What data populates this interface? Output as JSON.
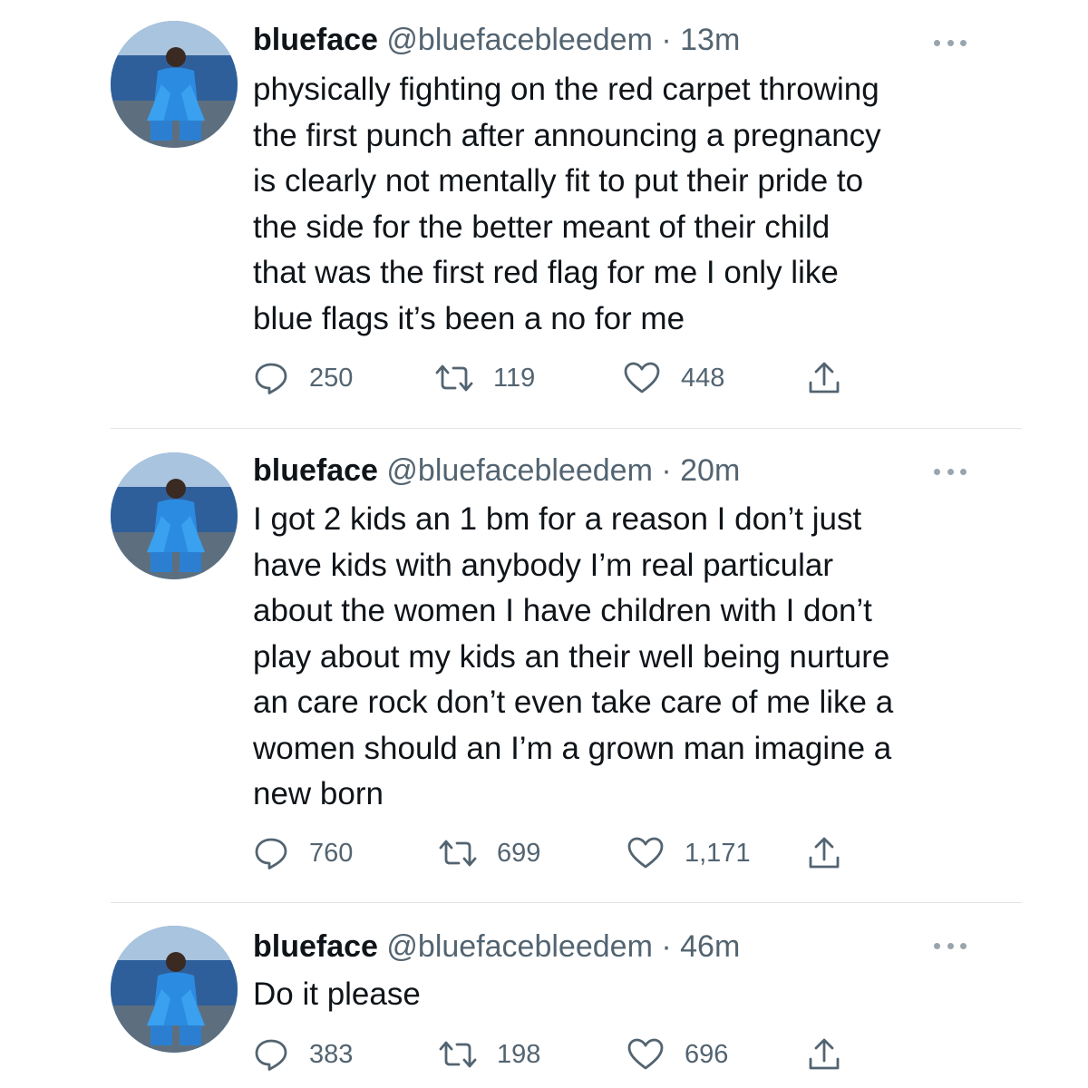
{
  "colors": {
    "text": "#0f1419",
    "secondary": "#536471",
    "divider": "#e2e5e8",
    "background": "#ffffff"
  },
  "icons": {
    "reply": "reply-icon",
    "retweet": "retweet-icon",
    "like": "heart-icon",
    "share": "share-icon",
    "more": "more-options-icon"
  },
  "tweets": [
    {
      "name": "blueface",
      "handle": "@bluefacebleedem",
      "separator": "·",
      "time": "13m",
      "lines": [
        "physically fighting on the red carpet throwing",
        "the first punch after announcing a pregnancy",
        "is clearly not mentally fit to put their pride to",
        "the side for the better meant of their child",
        "that was the first red flag for me I only like",
        "blue flags it’s been a no for me"
      ],
      "replies": "250",
      "retweets": "119",
      "likes": "448"
    },
    {
      "name": "blueface",
      "handle": "@bluefacebleedem",
      "separator": "·",
      "time": "20m",
      "lines": [
        "I got 2 kids an 1 bm for a reason I don’t just",
        "have kids with anybody I’m real particular",
        "about the women I have children with I don’t",
        "play about my kids an their well being nurture",
        "an care rock don’t even take care of me like a",
        "women should an I’m a grown man imagine a",
        "new born"
      ],
      "replies": "760",
      "retweets": "699",
      "likes": "1,171"
    },
    {
      "name": "blueface",
      "handle": "@bluefacebleedem",
      "separator": "·",
      "time": "46m",
      "lines": [
        "Do it please"
      ],
      "replies": "383",
      "retweets": "198",
      "likes": "696"
    }
  ]
}
